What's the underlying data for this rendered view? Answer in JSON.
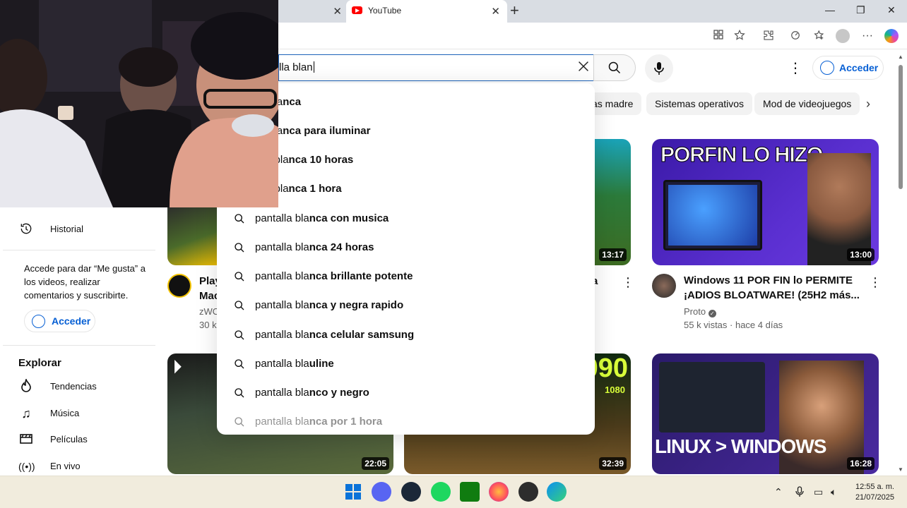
{
  "browser": {
    "active_tab_title": "YouTube",
    "close_glyph": "✕",
    "new_tab_glyph": "+",
    "window_controls": [
      "—",
      "❐",
      "✕"
    ]
  },
  "youtube": {
    "search_query": "lla blan",
    "signin_label": "Acceder",
    "chips": [
      "as madre",
      "Sistemas operativos",
      "Mod de videojuegos"
    ]
  },
  "suggestions": [
    {
      "prefix": "",
      "typed": "lla bla",
      "rest": "nca"
    },
    {
      "prefix": "",
      "typed": "lla bla",
      "rest": "nca para iluminar"
    },
    {
      "prefix": "",
      "typed": "alla bla",
      "rest": "nca 10 horas"
    },
    {
      "prefix": "",
      "typed": "alla bla",
      "rest": "nca 1 hora"
    },
    {
      "prefix": "",
      "typed": "pantalla bla",
      "rest": "nca con musica"
    },
    {
      "prefix": "",
      "typed": "pantalla bla",
      "rest": "nca 24 horas"
    },
    {
      "prefix": "",
      "typed": "pantalla bla",
      "rest": "nca brillante potente"
    },
    {
      "prefix": "",
      "typed": "pantalla bla",
      "rest": "nca y negra rapido"
    },
    {
      "prefix": "",
      "typed": "pantalla bla",
      "rest": "nca celular samsung"
    },
    {
      "prefix": "",
      "typed": "pantalla bla",
      "rest": "uline"
    },
    {
      "prefix": "",
      "typed": "pantalla bla",
      "rest": "nco y negro"
    },
    {
      "prefix": "",
      "typed": "pantalla bla",
      "rest": "nca por 1 hora"
    }
  ],
  "sidebar": {
    "historial": "Historial",
    "signin_note": "Accede para dar “Me gusta” a los videos, realizar comentarios y suscribirte.",
    "signin_label": "Acceder",
    "explore_heading": "Explorar",
    "explore_items": [
      "Tendencias",
      "Música",
      "Películas",
      "En vivo"
    ]
  },
  "videos": {
    "v1": {
      "title_line1": "Play",
      "title_line2": "Mac",
      "channel": "zWO",
      "meta": "30 k"
    },
    "v2": {
      "duration": "13:17",
      "title_frag": "a"
    },
    "v3": {
      "duration": "13:00",
      "thumb_text": "PORFIN LO HIZO",
      "title_line1": "Windows 11 POR FIN lo PERMITE",
      "title_line2": "¡ADIOS BLOATWARE! (25H2 más...",
      "channel": "Proto",
      "meta": "55 k vistas · hace 4 días"
    },
    "v4": {
      "duration": "22:05"
    },
    "v5": {
      "duration": "32:39",
      "thumb_text": "090",
      "thumb_text2": "1080"
    },
    "v6": {
      "duration": "16:28",
      "thumb_text": "LINUX > WINDOWS"
    }
  },
  "taskbar": {
    "time": "12:55 a. m.",
    "date": "21/07/2025"
  },
  "colors": {
    "youtube_red": "#ff0000",
    "link_blue": "#065fd4",
    "search_focus": "#1c62b9",
    "taskbar": "#f1ecdd"
  }
}
